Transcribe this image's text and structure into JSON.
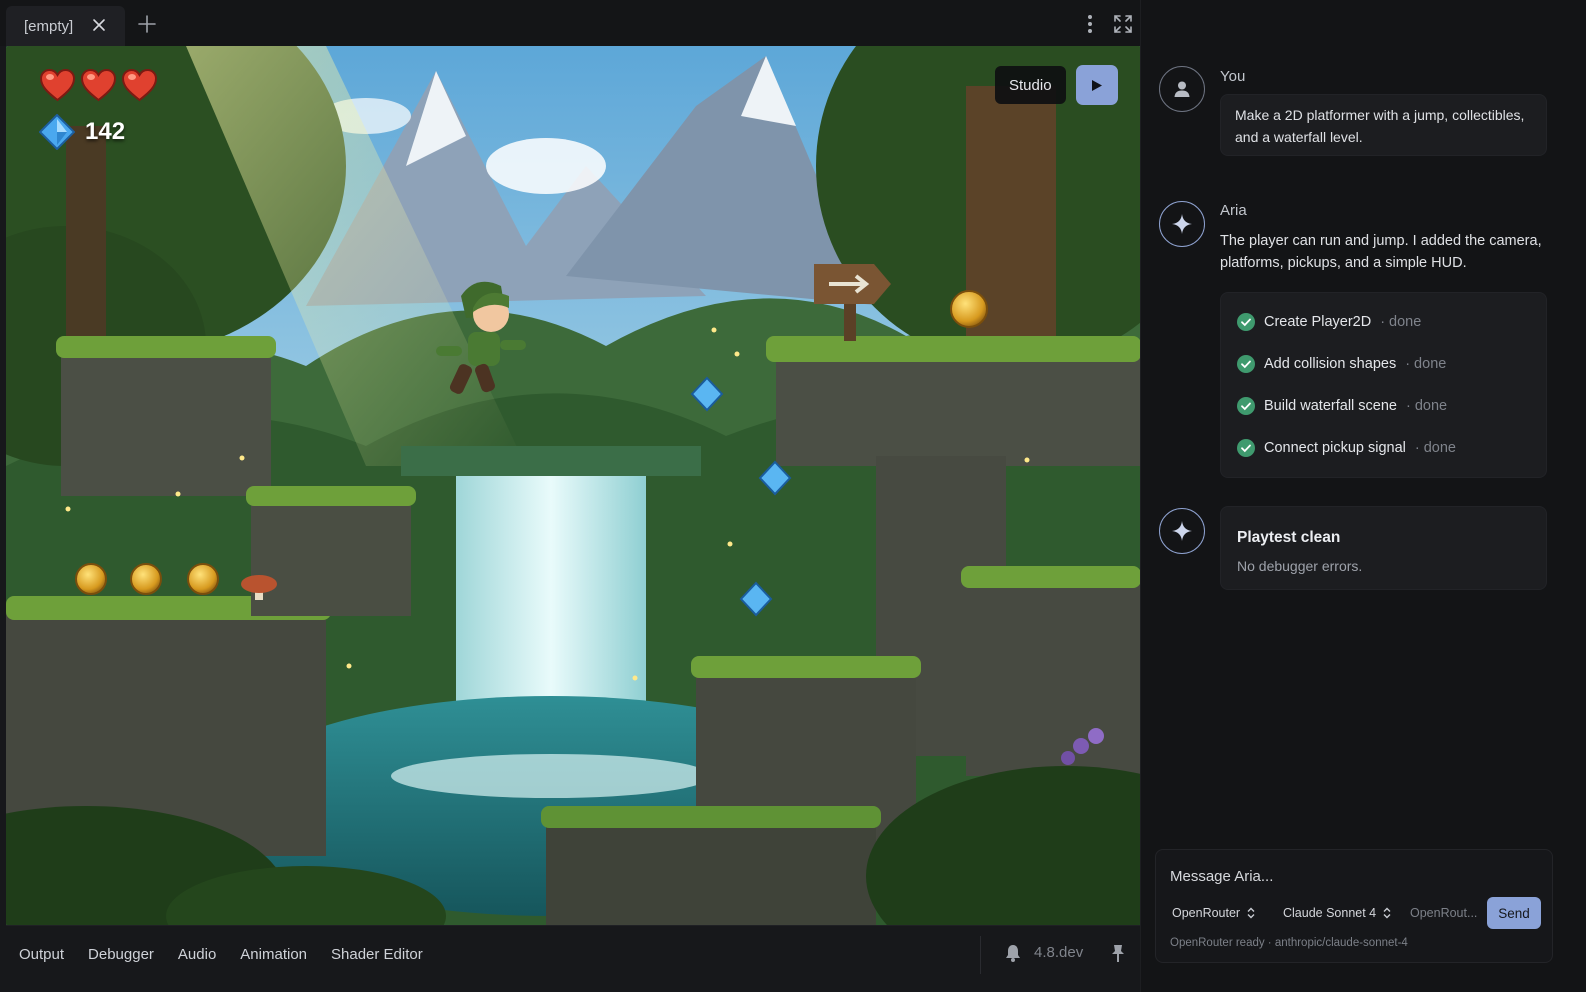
{
  "editor": {
    "tab_label": "[empty]",
    "studio_label": "Studio",
    "hud": {
      "hearts": 3,
      "gem_count": "142"
    },
    "bottom_tabs": [
      "Output",
      "Debugger",
      "Audio",
      "Animation",
      "Shader Editor"
    ],
    "version": "4.8.dev"
  },
  "chat": {
    "user": {
      "name": "You",
      "message": "Make a 2D platformer with a jump, collectibles, and a waterfall level."
    },
    "assistant": {
      "name": "Aria",
      "message": "The player can run and jump. I added the camera, platforms, pickups, and a simple HUD.",
      "tasks": [
        {
          "label": "Create Player2D",
          "status": "· done"
        },
        {
          "label": "Add collision shapes",
          "status": "· done"
        },
        {
          "label": "Build waterfall scene",
          "status": "· done"
        },
        {
          "label": "Connect pickup signal",
          "status": "· done"
        }
      ]
    },
    "result": {
      "title": "Playtest clean",
      "subtitle": "No debugger errors."
    },
    "composer": {
      "placeholder": "Message Aria...",
      "provider": "OpenRouter",
      "model": "Claude Sonnet 4",
      "key_hint": "OpenRout...",
      "send_label": "Send",
      "status": "OpenRouter ready · anthropic/claude-sonnet-4"
    }
  },
  "colors": {
    "accent": "#8aa2d8",
    "check_green": "#3f9a6e",
    "panel_bg": "#131416"
  }
}
